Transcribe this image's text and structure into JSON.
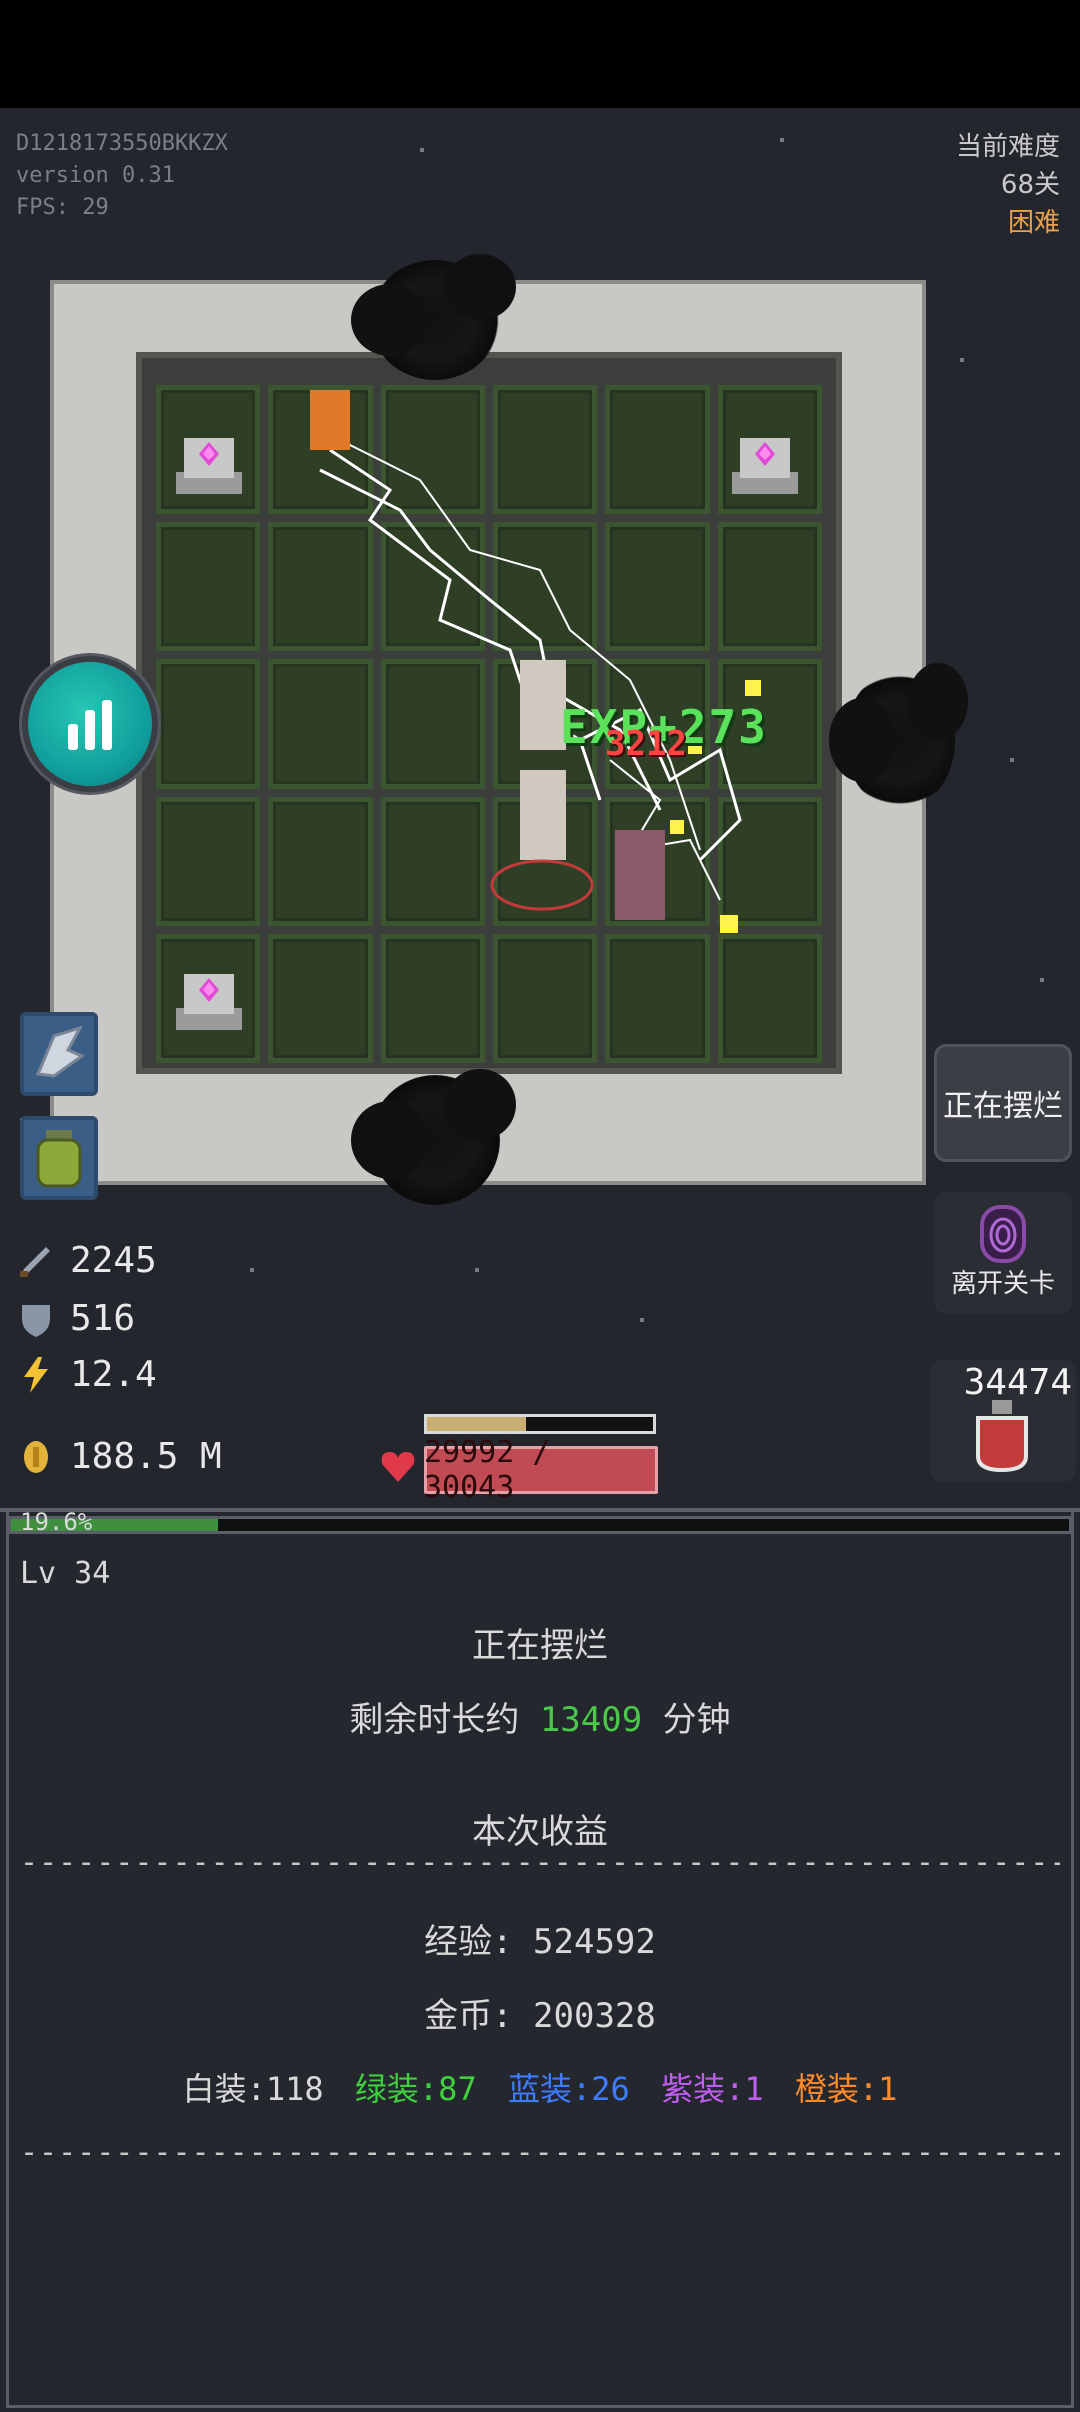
{
  "debug": {
    "device_id": "D1218173550BKKZX",
    "version": "version 0.31",
    "fps": "FPS: 29"
  },
  "difficulty": {
    "label": "当前难度",
    "stage": "68关",
    "level": "困难",
    "level_color": "#e9a14b"
  },
  "combat_text": {
    "exp": "EXP+273",
    "damage": "3212"
  },
  "stats": {
    "attack": "2245",
    "defense": "516",
    "speed": "12.4",
    "gold": "188.5 M"
  },
  "hud_icons": {
    "attack": "sword-icon",
    "defense": "shield-icon",
    "speed": "lightning-icon",
    "gold": "coin-icon",
    "quick_slot_1": "wing-icon",
    "quick_slot_2": "jar-icon",
    "stats_button": "bar-chart-icon"
  },
  "player": {
    "xp_fraction": 0.44,
    "hp_text": "29992 / 30043",
    "hp_current": 29992,
    "hp_max": 30043
  },
  "right_panel": {
    "idle_button": "正在摆烂",
    "leave_button": "离开关卡",
    "potion_count": "34474"
  },
  "level_panel": {
    "progress_text": "19.6%",
    "progress_fraction": 0.196,
    "level_text": "Lv 34",
    "status_title": "正在摆烂",
    "remaining_prefix": "剩余时长约",
    "remaining_minutes": "13409",
    "remaining_suffix": "分钟",
    "earnings_title": "本次收益",
    "dashes": "------------------------------------------------------------",
    "exp_line": "经验: 524592",
    "gold_line": "金币: 200328",
    "gear": [
      {
        "label": "白装:118",
        "color": "#d9d9d9"
      },
      {
        "label": "绿装:87",
        "color": "#3fcf3f"
      },
      {
        "label": "蓝装:26",
        "color": "#3d7bff"
      },
      {
        "label": "紫装:1",
        "color": "#c05cf0"
      },
      {
        "label": "橙装:1",
        "color": "#ff8a2a"
      }
    ]
  }
}
